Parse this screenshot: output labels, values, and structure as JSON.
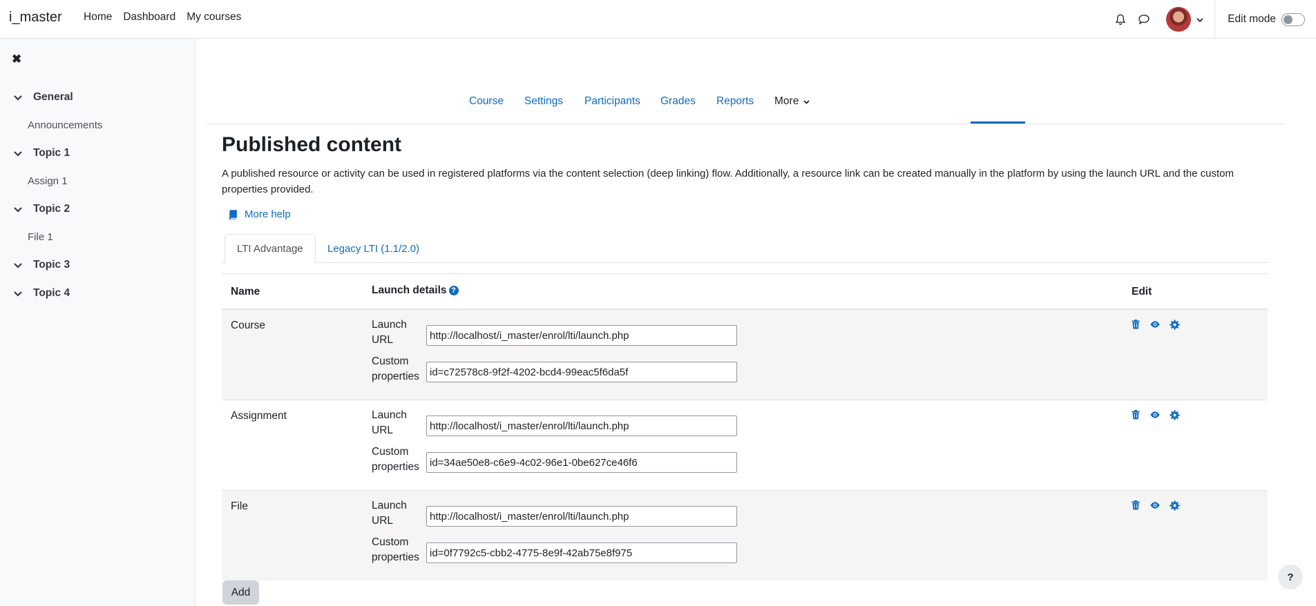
{
  "navbar": {
    "brand": "i_master",
    "links": [
      "Home",
      "Dashboard",
      "My courses"
    ],
    "edit_mode_label": "Edit mode",
    "icons": [
      "bell-icon",
      "chat-icon",
      "avatar",
      "chevron-down-icon"
    ]
  },
  "drawer": {
    "close_icon": "close-icon",
    "sections": [
      {
        "label": "General",
        "activities": [
          "Announcements"
        ]
      },
      {
        "label": "Topic 1",
        "activities": [
          "Assign 1"
        ]
      },
      {
        "label": "Topic 2",
        "activities": [
          "File 1"
        ]
      },
      {
        "label": "Topic 3",
        "activities": []
      },
      {
        "label": "Topic 4",
        "activities": []
      }
    ]
  },
  "secondary_nav": {
    "items": [
      "Course",
      "Settings",
      "Participants",
      "Grades",
      "Reports",
      "More"
    ],
    "active": "More"
  },
  "main": {
    "title": "Published content",
    "intro": "A published resource or activity can be used in registered platforms via the content selection (deep linking) flow. Additionally, a resource link can be created manually in the platform by using the launch URL and the custom properties provided.",
    "more_help": "More help",
    "tabs": [
      "LTI Advantage",
      "Legacy LTI (1.1/2.0)"
    ],
    "table": {
      "headers": {
        "name": "Name",
        "launch": "Launch details",
        "edit": "Edit"
      },
      "launch_label_1": "Launch",
      "launch_label_2": "URL",
      "custom_label_1": "Custom",
      "custom_label_2": "properties",
      "rows": [
        {
          "name": "Course",
          "launch_url": "http://localhost/i_master/enrol/lti/launch.php",
          "custom": "id=c72578c8-9f2f-4202-bcd4-99eac5f6da5f"
        },
        {
          "name": "Assignment",
          "launch_url": "http://localhost/i_master/enrol/lti/launch.php",
          "custom": "id=34ae50e8-c6e9-4c02-96e1-0be627ce46f6"
        },
        {
          "name": "File",
          "launch_url": "http://localhost/i_master/enrol/lti/launch.php",
          "custom": "id=0f7792c5-cbb2-4775-8e9f-42ab75e8f975"
        }
      ],
      "row_actions": [
        "trash-icon",
        "eye-icon",
        "gear-icon"
      ]
    },
    "add_button": "Add",
    "help_fab": "?"
  }
}
